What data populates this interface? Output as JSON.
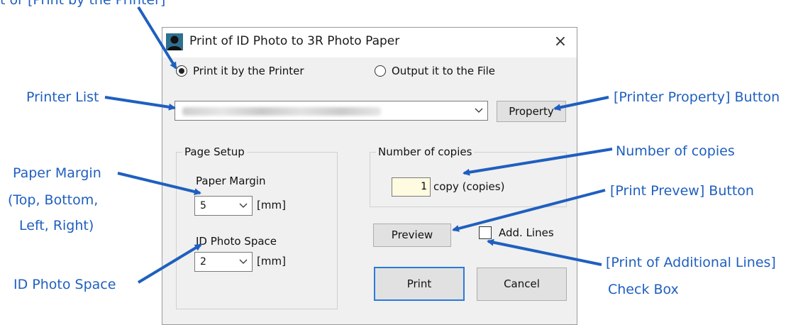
{
  "dialog": {
    "title": "Print of ID Photo to 3R Photo Paper",
    "close_symbol": "×",
    "app_icon": "person-silhouette-icon",
    "radio_printer_label": "Print it by the Printer",
    "radio_file_label": "Output it to the File",
    "radio_selected": "printer",
    "printer_selected": "",
    "property_button": "Property",
    "page_setup_group": "Page Setup",
    "paper_margin_label": "Paper Margin",
    "paper_margin_value": "5",
    "paper_margin_unit": "[mm]",
    "id_photo_space_label": "ID Photo Space",
    "id_photo_space_value": "2",
    "id_photo_space_unit": "[mm]",
    "copies_group": "Number of copies",
    "copies_value": "1",
    "copies_unit": "copy (copies)",
    "preview_button": "Preview",
    "add_lines_label": "Add. Lines",
    "add_lines_checked": false,
    "print_button": "Print",
    "cancel_button": "Cancel"
  },
  "annotations": {
    "top_cut": "t or [Print by the Printer]",
    "printer_list": "Printer List",
    "paper_margin_1": "Paper Margin",
    "paper_margin_2": "(Top, Bottom,",
    "paper_margin_3": "Left, Right)",
    "id_photo_space": "ID Photo Space",
    "printer_property": "[Printer Property] Button",
    "number_of_copies": "Number of copies",
    "print_preview": "[Print Prevew] Button",
    "add_lines_1": "[Print of Additional Lines]",
    "add_lines_2": "Check Box"
  },
  "colors": {
    "annotation": "#1f5fbf",
    "dialog_bg": "#f0f0f0",
    "default_button_border": "#2a7bd8",
    "copies_field_bg": "#fffbe0"
  }
}
